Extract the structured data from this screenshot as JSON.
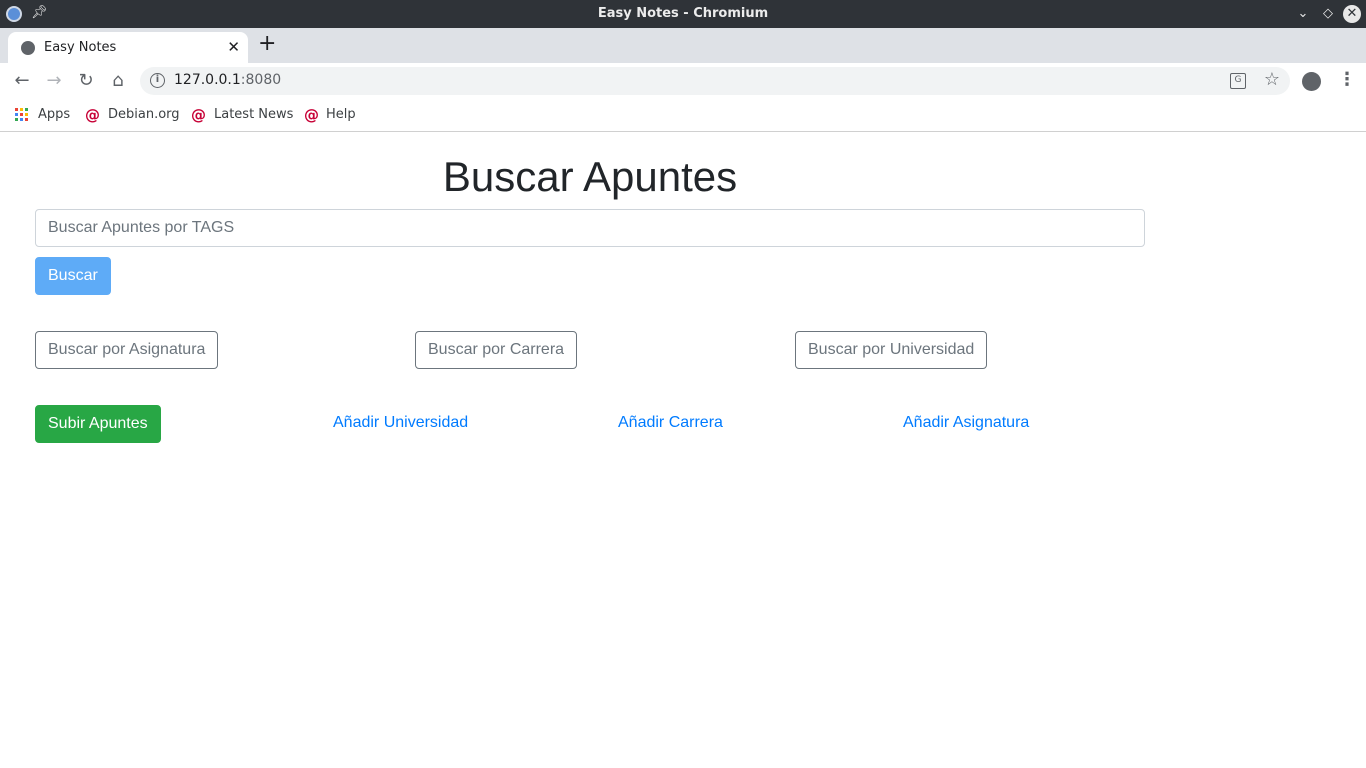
{
  "window": {
    "title": "Easy Notes - Chromium"
  },
  "tab": {
    "title": "Easy Notes"
  },
  "address_bar": {
    "host": "127.0.0.1",
    "port": ":8080"
  },
  "bookmarks": [
    {
      "label": "Apps",
      "icon": "apps-grid-icon"
    },
    {
      "label": "Debian.org",
      "icon": "debian-icon"
    },
    {
      "label": "Latest News",
      "icon": "debian-icon"
    },
    {
      "label": "Help",
      "icon": "debian-icon"
    }
  ],
  "page": {
    "heading": "Buscar Apuntes",
    "search_placeholder": "Buscar Apuntes por TAGS",
    "search_button": "Buscar",
    "filter_buttons": {
      "asignatura": "Buscar por Asignatura",
      "carrera": "Buscar por Carrera",
      "universidad": "Buscar por Universidad"
    },
    "upload_button": "Subir Apuntes",
    "links": {
      "universidad": "Añadir Universidad",
      "carrera": "Añadir Carrera",
      "asignatura": "Añadir Asignatura"
    }
  },
  "colors": {
    "primary_light": "#5eabf7",
    "success": "#28a745",
    "link": "#007bff",
    "secondary": "#6c757d",
    "debian_red": "#c70036"
  }
}
